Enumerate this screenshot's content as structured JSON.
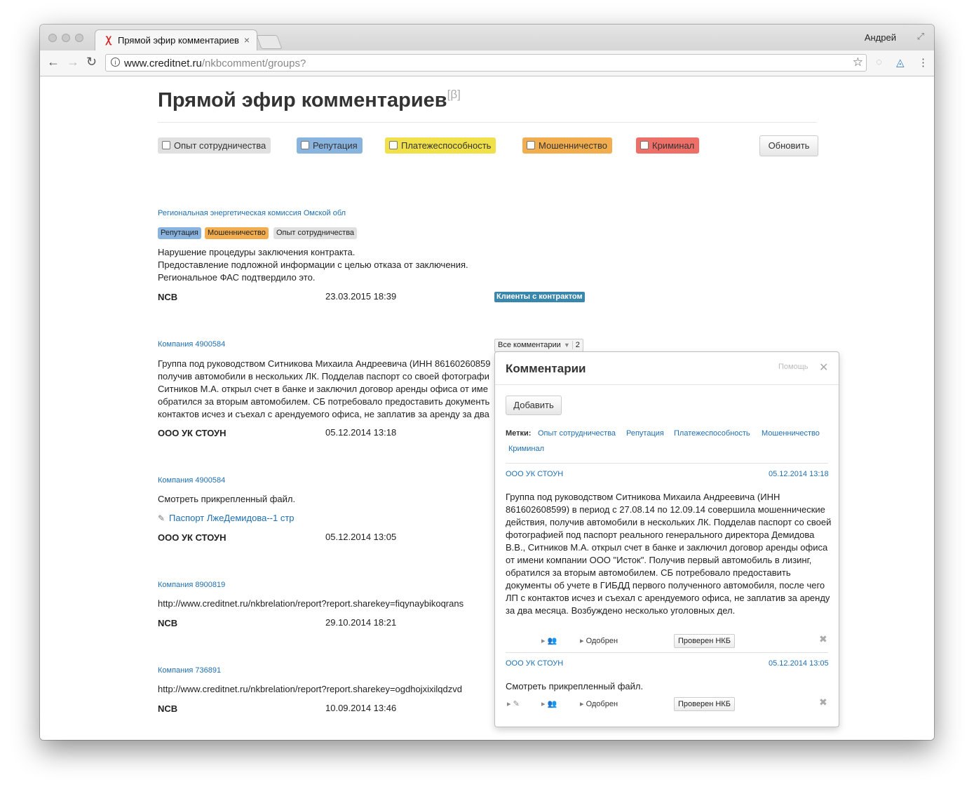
{
  "browser": {
    "tab_title": "Прямой эфир комментариев",
    "tab_close": "×",
    "profile_name": "Андрей",
    "url_domain": "www.creditnet.ru",
    "url_path": "/nkbcomment/groups?"
  },
  "page": {
    "title": "Прямой эфир комментариев",
    "beta": "[β]",
    "filters": [
      {
        "label": "Опыт сотрудничества",
        "color": "#e0e0e0"
      },
      {
        "label": "Репутация",
        "color": "#8ab4e0"
      },
      {
        "label": "Платежеспособность",
        "color": "#f0e04a"
      },
      {
        "label": "Мошенничество",
        "color": "#f2ad4e"
      },
      {
        "label": "Криминал",
        "color": "#ee6f68"
      }
    ],
    "refresh_label": "Обновить"
  },
  "entries": [
    {
      "company": "Региональная энергетическая комиссия Омской обл",
      "tags": [
        {
          "label": "Репутация",
          "color": "#8ab4e0"
        },
        {
          "label": "Мошенничество",
          "color": "#f2ad4e"
        },
        {
          "label": "Опыт сотрудничества",
          "color": "#e0e0e0"
        }
      ],
      "lines": [
        "Нарушение процедуры заключения контракта.",
        "Предоставление подложной информации с целью отказа от заключения.",
        "Региональное ФАС подтвердило это."
      ],
      "author": "NCB",
      "date": "23.03.2015 18:39",
      "badge": "Клиенты с контрактом"
    },
    {
      "company": "Компания 4900584",
      "lines": [
        "Группа под руководством Ситникова Михаила Андреевича (ИНН 86160260859",
        "получив автомобили в нескольких ЛК. Подделав паспорт со своей фотографи",
        "Ситников М.А. открыл счет в банке и заключил договор аренды офиса от име",
        "обратился за вторым автомобилем. СБ потребовало предоставить документь",
        "контактов исчез и съехал с арендуемого офиса, не заплатив за аренду за два"
      ],
      "author": "ООО УК СТОУН",
      "date": "05.12.2014 13:18",
      "dropdown": {
        "label": "Все комментарии",
        "count": "2"
      }
    },
    {
      "company": "Компания 4900584",
      "lines": [
        "Смотреть прикрепленный файл."
      ],
      "attachment": "Паспорт ЛжеДемидова--1 стр",
      "author": "ООО УК СТОУН",
      "date": "05.12.2014 13:05"
    },
    {
      "company": "Компания 8900819",
      "lines": [
        "http://www.creditnet.ru/nkbrelation/report?report.sharekey=fiqynaybikoqrans"
      ],
      "author": "NCB",
      "date": "29.10.2014 18:21"
    },
    {
      "company": "Компания 736891",
      "lines": [
        "http://www.creditnet.ru/nkbrelation/report?report.sharekey=ogdhojxixilqdzvd"
      ],
      "author": "NCB",
      "date": "10.09.2014 13:46"
    }
  ],
  "panel": {
    "title": "Комментарии",
    "help": "Помощь",
    "close": "✕",
    "add_label": "Добавить",
    "marks_label": "Метки:",
    "marks": [
      "Опыт сотрудничества",
      "Репутация",
      "Платежеспособность",
      "Мошенничество",
      "Криминал"
    ],
    "comments": [
      {
        "author": "ООО УК СТОУН",
        "date": "05.12.2014 13:18",
        "text": "Группа под руководством Ситникова Михаила Андреевича (ИНН 861602608599) в период с 27.08.14 по 12.09.14 совершила мошеннические действия, получив автомобили в нескольких ЛК. Подделав паспорт со своей фотографией под паспорт реального генерального директора Демидова В.В., Ситников М.А. открыл счет в банке и заключил договор аренды офиса от имени компании ООО \"Исток\". Получив первый автомобиль в лизинг, обратился за вторым автомобилем. СБ потребовало предоставить документы об учете в ГИБДД первого полученного автомобиля, после чего ЛП с контактов исчез и съехал с арендуемого офиса, не заплатив за аренду за два месяца. Возбуждено несколько уголовных дел.",
        "status": "Одобрен",
        "verify": "Проверен НКБ"
      },
      {
        "author": "ООО УК СТОУН",
        "date": "05.12.2014 13:05",
        "text": "Смотреть прикрепленный файл.",
        "status": "Одобрен",
        "verify": "Проверен НКБ"
      }
    ]
  },
  "icons": {
    "back": "arrow-left-icon",
    "forward": "arrow-right-icon",
    "reload": "reload-icon",
    "info": "info-icon",
    "star": "bookmark-star-icon",
    "menu": "kebab-menu-icon",
    "attachment": "paperclip-icon",
    "users": "users-icon",
    "delete": "delete-x-icon"
  }
}
